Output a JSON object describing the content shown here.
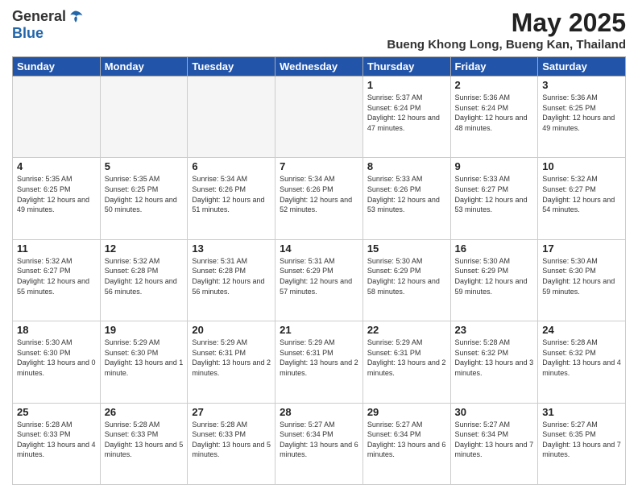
{
  "header": {
    "logo_general": "General",
    "logo_blue": "Blue",
    "title": "May 2025",
    "subtitle": "Bueng Khong Long, Bueng Kan, Thailand"
  },
  "days_of_week": [
    "Sunday",
    "Monday",
    "Tuesday",
    "Wednesday",
    "Thursday",
    "Friday",
    "Saturday"
  ],
  "weeks": [
    [
      {
        "day": "",
        "info": ""
      },
      {
        "day": "",
        "info": ""
      },
      {
        "day": "",
        "info": ""
      },
      {
        "day": "",
        "info": ""
      },
      {
        "day": "1",
        "info": "Sunrise: 5:37 AM\nSunset: 6:24 PM\nDaylight: 12 hours and 47 minutes."
      },
      {
        "day": "2",
        "info": "Sunrise: 5:36 AM\nSunset: 6:24 PM\nDaylight: 12 hours and 48 minutes."
      },
      {
        "day": "3",
        "info": "Sunrise: 5:36 AM\nSunset: 6:25 PM\nDaylight: 12 hours and 49 minutes."
      }
    ],
    [
      {
        "day": "4",
        "info": "Sunrise: 5:35 AM\nSunset: 6:25 PM\nDaylight: 12 hours and 49 minutes."
      },
      {
        "day": "5",
        "info": "Sunrise: 5:35 AM\nSunset: 6:25 PM\nDaylight: 12 hours and 50 minutes."
      },
      {
        "day": "6",
        "info": "Sunrise: 5:34 AM\nSunset: 6:26 PM\nDaylight: 12 hours and 51 minutes."
      },
      {
        "day": "7",
        "info": "Sunrise: 5:34 AM\nSunset: 6:26 PM\nDaylight: 12 hours and 52 minutes."
      },
      {
        "day": "8",
        "info": "Sunrise: 5:33 AM\nSunset: 6:26 PM\nDaylight: 12 hours and 53 minutes."
      },
      {
        "day": "9",
        "info": "Sunrise: 5:33 AM\nSunset: 6:27 PM\nDaylight: 12 hours and 53 minutes."
      },
      {
        "day": "10",
        "info": "Sunrise: 5:32 AM\nSunset: 6:27 PM\nDaylight: 12 hours and 54 minutes."
      }
    ],
    [
      {
        "day": "11",
        "info": "Sunrise: 5:32 AM\nSunset: 6:27 PM\nDaylight: 12 hours and 55 minutes."
      },
      {
        "day": "12",
        "info": "Sunrise: 5:32 AM\nSunset: 6:28 PM\nDaylight: 12 hours and 56 minutes."
      },
      {
        "day": "13",
        "info": "Sunrise: 5:31 AM\nSunset: 6:28 PM\nDaylight: 12 hours and 56 minutes."
      },
      {
        "day": "14",
        "info": "Sunrise: 5:31 AM\nSunset: 6:29 PM\nDaylight: 12 hours and 57 minutes."
      },
      {
        "day": "15",
        "info": "Sunrise: 5:30 AM\nSunset: 6:29 PM\nDaylight: 12 hours and 58 minutes."
      },
      {
        "day": "16",
        "info": "Sunrise: 5:30 AM\nSunset: 6:29 PM\nDaylight: 12 hours and 59 minutes."
      },
      {
        "day": "17",
        "info": "Sunrise: 5:30 AM\nSunset: 6:30 PM\nDaylight: 12 hours and 59 minutes."
      }
    ],
    [
      {
        "day": "18",
        "info": "Sunrise: 5:30 AM\nSunset: 6:30 PM\nDaylight: 13 hours and 0 minutes."
      },
      {
        "day": "19",
        "info": "Sunrise: 5:29 AM\nSunset: 6:30 PM\nDaylight: 13 hours and 1 minute."
      },
      {
        "day": "20",
        "info": "Sunrise: 5:29 AM\nSunset: 6:31 PM\nDaylight: 13 hours and 2 minutes."
      },
      {
        "day": "21",
        "info": "Sunrise: 5:29 AM\nSunset: 6:31 PM\nDaylight: 13 hours and 2 minutes."
      },
      {
        "day": "22",
        "info": "Sunrise: 5:29 AM\nSunset: 6:31 PM\nDaylight: 13 hours and 2 minutes."
      },
      {
        "day": "23",
        "info": "Sunrise: 5:28 AM\nSunset: 6:32 PM\nDaylight: 13 hours and 3 minutes."
      },
      {
        "day": "24",
        "info": "Sunrise: 5:28 AM\nSunset: 6:32 PM\nDaylight: 13 hours and 4 minutes."
      }
    ],
    [
      {
        "day": "25",
        "info": "Sunrise: 5:28 AM\nSunset: 6:33 PM\nDaylight: 13 hours and 4 minutes."
      },
      {
        "day": "26",
        "info": "Sunrise: 5:28 AM\nSunset: 6:33 PM\nDaylight: 13 hours and 5 minutes."
      },
      {
        "day": "27",
        "info": "Sunrise: 5:28 AM\nSunset: 6:33 PM\nDaylight: 13 hours and 5 minutes."
      },
      {
        "day": "28",
        "info": "Sunrise: 5:27 AM\nSunset: 6:34 PM\nDaylight: 13 hours and 6 minutes."
      },
      {
        "day": "29",
        "info": "Sunrise: 5:27 AM\nSunset: 6:34 PM\nDaylight: 13 hours and 6 minutes."
      },
      {
        "day": "30",
        "info": "Sunrise: 5:27 AM\nSunset: 6:34 PM\nDaylight: 13 hours and 7 minutes."
      },
      {
        "day": "31",
        "info": "Sunrise: 5:27 AM\nSunset: 6:35 PM\nDaylight: 13 hours and 7 minutes."
      }
    ]
  ]
}
